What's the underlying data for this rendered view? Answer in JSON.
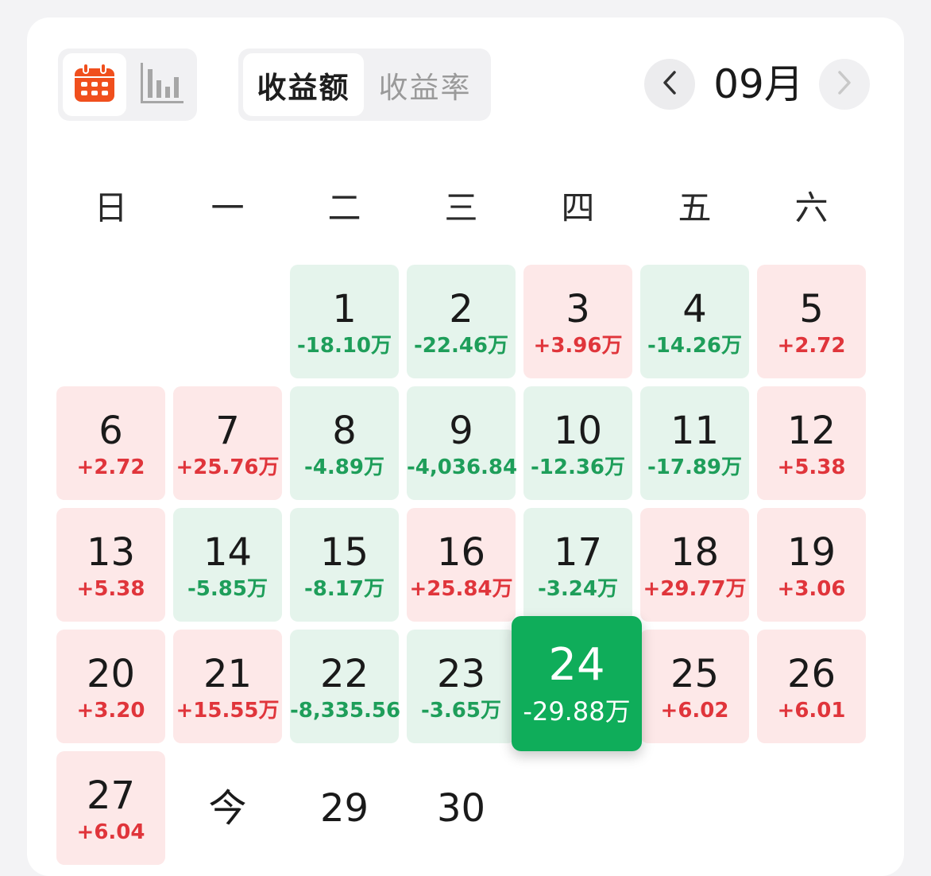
{
  "toolbar": {
    "calendar_view_icon": "calendar-icon",
    "chart_view_icon": "bar-chart-icon",
    "segments": [
      "收益额",
      "收益率"
    ],
    "active_segment": "收益额",
    "prev_icon": "chevron-left-icon",
    "next_icon": "chevron-right-icon",
    "month_label": "09月"
  },
  "colors": {
    "gain": "#e0353b",
    "gain_bg": "#fde8e8",
    "loss": "#1e9e5a",
    "loss_bg": "#e5f4ec",
    "selected": "#0fad5a",
    "calendar_icon": "#f04f1d"
  },
  "weekdays": [
    "日",
    "一",
    "二",
    "三",
    "四",
    "五",
    "六"
  ],
  "days": [
    {
      "day": "1",
      "value": "-18.10万",
      "trend": "down"
    },
    {
      "day": "2",
      "value": "-22.46万",
      "trend": "down"
    },
    {
      "day": "3",
      "value": "+3.96万",
      "trend": "up"
    },
    {
      "day": "4",
      "value": "-14.26万",
      "trend": "down"
    },
    {
      "day": "5",
      "value": "+2.72",
      "trend": "up"
    },
    {
      "day": "6",
      "value": "+2.72",
      "trend": "up"
    },
    {
      "day": "7",
      "value": "+25.76万",
      "trend": "up"
    },
    {
      "day": "8",
      "value": "-4.89万",
      "trend": "down"
    },
    {
      "day": "9",
      "value": "-4,036.84",
      "trend": "down"
    },
    {
      "day": "10",
      "value": "-12.36万",
      "trend": "down"
    },
    {
      "day": "11",
      "value": "-17.89万",
      "trend": "down"
    },
    {
      "day": "12",
      "value": "+5.38",
      "trend": "up"
    },
    {
      "day": "13",
      "value": "+5.38",
      "trend": "up"
    },
    {
      "day": "14",
      "value": "-5.85万",
      "trend": "down"
    },
    {
      "day": "15",
      "value": "-8.17万",
      "trend": "down"
    },
    {
      "day": "16",
      "value": "+25.84万",
      "trend": "up"
    },
    {
      "day": "17",
      "value": "-3.24万",
      "trend": "down"
    },
    {
      "day": "18",
      "value": "+29.77万",
      "trend": "up"
    },
    {
      "day": "19",
      "value": "+3.06",
      "trend": "up"
    },
    {
      "day": "20",
      "value": "+3.20",
      "trend": "up"
    },
    {
      "day": "21",
      "value": "+15.55万",
      "trend": "up"
    },
    {
      "day": "22",
      "value": "-8,335.56",
      "trend": "down"
    },
    {
      "day": "23",
      "value": "-3.65万",
      "trend": "down"
    },
    {
      "day": "24",
      "value": "-29.88万",
      "trend": "selected"
    },
    {
      "day": "25",
      "value": "+6.02",
      "trend": "up"
    },
    {
      "day": "26",
      "value": "+6.01",
      "trend": "up"
    },
    {
      "day": "27",
      "value": "+6.04",
      "trend": "up"
    },
    {
      "day": "今",
      "value": "",
      "trend": "plain"
    },
    {
      "day": "29",
      "value": "",
      "trend": "plain"
    },
    {
      "day": "30",
      "value": "",
      "trend": "plain"
    }
  ],
  "first_weekday_index": 2
}
